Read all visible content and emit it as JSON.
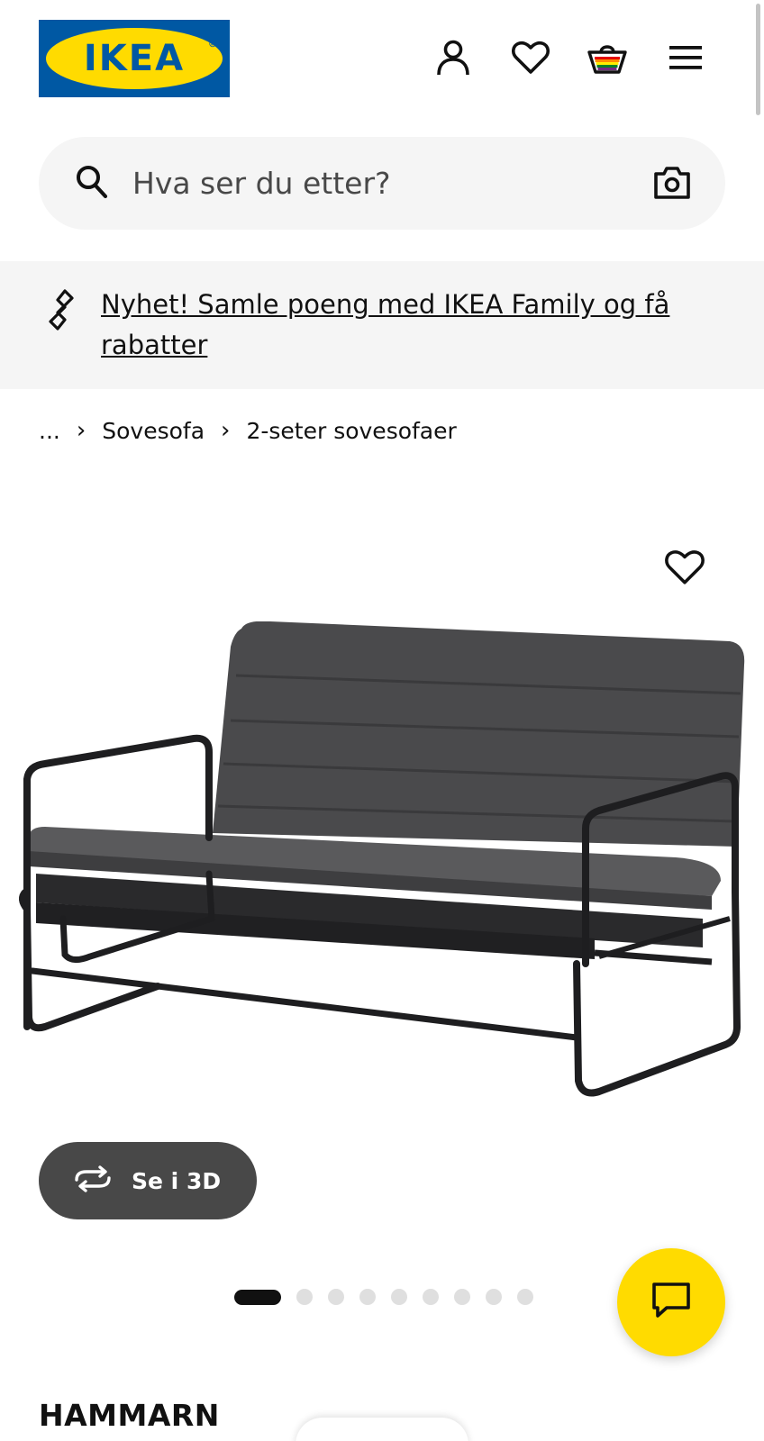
{
  "header": {
    "logo_text": "IKEA",
    "logo_reg": "®",
    "icons": [
      "user-icon",
      "heart-icon",
      "shopping-bag-icon",
      "menu-icon"
    ]
  },
  "search": {
    "placeholder": "Hva ser du etter?",
    "icons": [
      "search-icon",
      "camera-icon"
    ]
  },
  "banner": {
    "text": "Nyhet! Samle poeng med IKEA Family og få rabatter",
    "icon": "ikea-family-icon"
  },
  "breadcrumb": {
    "ellipsis": "...",
    "items": [
      "Sovesofa",
      "2-seter sovesofaer"
    ]
  },
  "product": {
    "view3d_label": "Se i 3D",
    "name": "HAMMARN",
    "image_count": 9,
    "active_image_index": 0
  },
  "colors": {
    "ikea_blue": "#0058a3",
    "ikea_yellow": "#ffdb00",
    "dark_grey": "#484848",
    "light_grey": "#f5f5f5"
  }
}
